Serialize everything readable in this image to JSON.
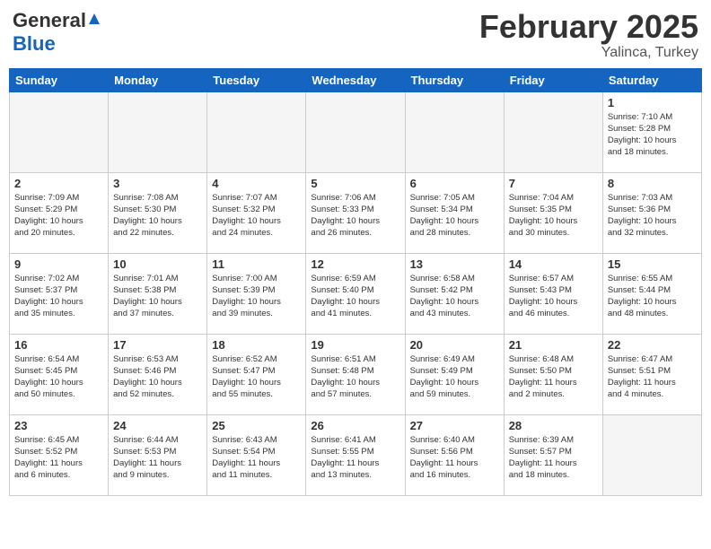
{
  "header": {
    "logo_general": "General",
    "logo_blue": "Blue",
    "title": "February 2025",
    "subtitle": "Yalinca, Turkey"
  },
  "day_headers": [
    "Sunday",
    "Monday",
    "Tuesday",
    "Wednesday",
    "Thursday",
    "Friday",
    "Saturday"
  ],
  "weeks": [
    {
      "days": [
        {
          "num": "",
          "info": "",
          "empty": true
        },
        {
          "num": "",
          "info": "",
          "empty": true
        },
        {
          "num": "",
          "info": "",
          "empty": true
        },
        {
          "num": "",
          "info": "",
          "empty": true
        },
        {
          "num": "",
          "info": "",
          "empty": true
        },
        {
          "num": "",
          "info": "",
          "empty": true
        },
        {
          "num": "1",
          "info": "Sunrise: 7:10 AM\nSunset: 5:28 PM\nDaylight: 10 hours\nand 18 minutes.",
          "empty": false
        }
      ]
    },
    {
      "days": [
        {
          "num": "2",
          "info": "Sunrise: 7:09 AM\nSunset: 5:29 PM\nDaylight: 10 hours\nand 20 minutes.",
          "empty": false
        },
        {
          "num": "3",
          "info": "Sunrise: 7:08 AM\nSunset: 5:30 PM\nDaylight: 10 hours\nand 22 minutes.",
          "empty": false
        },
        {
          "num": "4",
          "info": "Sunrise: 7:07 AM\nSunset: 5:32 PM\nDaylight: 10 hours\nand 24 minutes.",
          "empty": false
        },
        {
          "num": "5",
          "info": "Sunrise: 7:06 AM\nSunset: 5:33 PM\nDaylight: 10 hours\nand 26 minutes.",
          "empty": false
        },
        {
          "num": "6",
          "info": "Sunrise: 7:05 AM\nSunset: 5:34 PM\nDaylight: 10 hours\nand 28 minutes.",
          "empty": false
        },
        {
          "num": "7",
          "info": "Sunrise: 7:04 AM\nSunset: 5:35 PM\nDaylight: 10 hours\nand 30 minutes.",
          "empty": false
        },
        {
          "num": "8",
          "info": "Sunrise: 7:03 AM\nSunset: 5:36 PM\nDaylight: 10 hours\nand 32 minutes.",
          "empty": false
        }
      ]
    },
    {
      "days": [
        {
          "num": "9",
          "info": "Sunrise: 7:02 AM\nSunset: 5:37 PM\nDaylight: 10 hours\nand 35 minutes.",
          "empty": false
        },
        {
          "num": "10",
          "info": "Sunrise: 7:01 AM\nSunset: 5:38 PM\nDaylight: 10 hours\nand 37 minutes.",
          "empty": false
        },
        {
          "num": "11",
          "info": "Sunrise: 7:00 AM\nSunset: 5:39 PM\nDaylight: 10 hours\nand 39 minutes.",
          "empty": false
        },
        {
          "num": "12",
          "info": "Sunrise: 6:59 AM\nSunset: 5:40 PM\nDaylight: 10 hours\nand 41 minutes.",
          "empty": false
        },
        {
          "num": "13",
          "info": "Sunrise: 6:58 AM\nSunset: 5:42 PM\nDaylight: 10 hours\nand 43 minutes.",
          "empty": false
        },
        {
          "num": "14",
          "info": "Sunrise: 6:57 AM\nSunset: 5:43 PM\nDaylight: 10 hours\nand 46 minutes.",
          "empty": false
        },
        {
          "num": "15",
          "info": "Sunrise: 6:55 AM\nSunset: 5:44 PM\nDaylight: 10 hours\nand 48 minutes.",
          "empty": false
        }
      ]
    },
    {
      "days": [
        {
          "num": "16",
          "info": "Sunrise: 6:54 AM\nSunset: 5:45 PM\nDaylight: 10 hours\nand 50 minutes.",
          "empty": false
        },
        {
          "num": "17",
          "info": "Sunrise: 6:53 AM\nSunset: 5:46 PM\nDaylight: 10 hours\nand 52 minutes.",
          "empty": false
        },
        {
          "num": "18",
          "info": "Sunrise: 6:52 AM\nSunset: 5:47 PM\nDaylight: 10 hours\nand 55 minutes.",
          "empty": false
        },
        {
          "num": "19",
          "info": "Sunrise: 6:51 AM\nSunset: 5:48 PM\nDaylight: 10 hours\nand 57 minutes.",
          "empty": false
        },
        {
          "num": "20",
          "info": "Sunrise: 6:49 AM\nSunset: 5:49 PM\nDaylight: 10 hours\nand 59 minutes.",
          "empty": false
        },
        {
          "num": "21",
          "info": "Sunrise: 6:48 AM\nSunset: 5:50 PM\nDaylight: 11 hours\nand 2 minutes.",
          "empty": false
        },
        {
          "num": "22",
          "info": "Sunrise: 6:47 AM\nSunset: 5:51 PM\nDaylight: 11 hours\nand 4 minutes.",
          "empty": false
        }
      ]
    },
    {
      "days": [
        {
          "num": "23",
          "info": "Sunrise: 6:45 AM\nSunset: 5:52 PM\nDaylight: 11 hours\nand 6 minutes.",
          "empty": false
        },
        {
          "num": "24",
          "info": "Sunrise: 6:44 AM\nSunset: 5:53 PM\nDaylight: 11 hours\nand 9 minutes.",
          "empty": false
        },
        {
          "num": "25",
          "info": "Sunrise: 6:43 AM\nSunset: 5:54 PM\nDaylight: 11 hours\nand 11 minutes.",
          "empty": false
        },
        {
          "num": "26",
          "info": "Sunrise: 6:41 AM\nSunset: 5:55 PM\nDaylight: 11 hours\nand 13 minutes.",
          "empty": false
        },
        {
          "num": "27",
          "info": "Sunrise: 6:40 AM\nSunset: 5:56 PM\nDaylight: 11 hours\nand 16 minutes.",
          "empty": false
        },
        {
          "num": "28",
          "info": "Sunrise: 6:39 AM\nSunset: 5:57 PM\nDaylight: 11 hours\nand 18 minutes.",
          "empty": false
        },
        {
          "num": "",
          "info": "",
          "empty": true
        }
      ]
    }
  ]
}
